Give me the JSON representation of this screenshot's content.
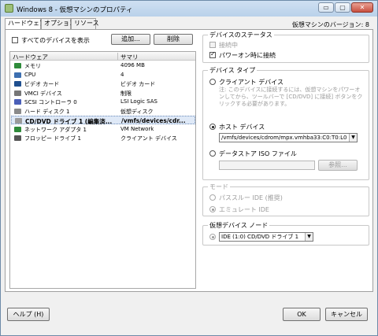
{
  "window": {
    "title": "Windows 8 - 仮想マシンのプロパティ"
  },
  "title_controls": {
    "minimize": "▭",
    "maximize": "▢",
    "close": "✕"
  },
  "tabs": [
    {
      "label": "ハードウェア",
      "active": true
    },
    {
      "label": "オプション",
      "active": false
    },
    {
      "label": "リソース",
      "active": false
    }
  ],
  "vm_version": "仮想マシンのバージョン: 8",
  "left": {
    "show_all_label": "すべてのデバイスを表示",
    "add_button": "追加...",
    "remove_button": "削除",
    "columns": {
      "hardware": "ハードウェア",
      "summary": "サマリ"
    },
    "devices": [
      {
        "name": "メモリ",
        "summary": "4096 MB",
        "icon": "memory-icon",
        "color": "#2e8b3a",
        "selected": false
      },
      {
        "name": "CPU",
        "summary": "4",
        "icon": "cpu-icon",
        "color": "#3d6fb0",
        "selected": false
      },
      {
        "name": "ビデオ カード",
        "summary": "ビデオ カード",
        "icon": "video-card-icon",
        "color": "#1f4f8f",
        "selected": false
      },
      {
        "name": "VMCI デバイス",
        "summary": "制限",
        "icon": "vmci-device-icon",
        "color": "#777777",
        "selected": false
      },
      {
        "name": "SCSI コントローラ 0",
        "summary": "LSI Logic SAS",
        "icon": "scsi-controller-icon",
        "color": "#4a5fb8",
        "selected": false
      },
      {
        "name": "ハード ディスク 1",
        "summary": "仮想ディスク",
        "icon": "hard-disk-icon",
        "color": "#8a8a8a",
        "selected": false
      },
      {
        "name": "CD/DVD ドライブ 1 (編集済...",
        "summary": "/vmfs/devices/cdr...",
        "icon": "cd-dvd-drive-icon",
        "color": "#9a9a9a",
        "selected": true
      },
      {
        "name": "ネットワーク アダプタ 1",
        "summary": "VM Network",
        "icon": "network-adapter-icon",
        "color": "#2f8a3a",
        "selected": false
      },
      {
        "name": "フロッピー ドライブ 1",
        "summary": "クライアント デバイス",
        "icon": "floppy-drive-icon",
        "color": "#555555",
        "selected": false
      }
    ]
  },
  "right": {
    "status": {
      "title": "デバイスのステータス",
      "connected": "接続中",
      "connect_at_power_on": "パワーオン時に接続"
    },
    "device_type": {
      "title": "デバイス タイプ",
      "client_device": "クライアント デバイス",
      "client_note": "注: このデバイスに接続するには、仮想マシンをパワーオンしてから、ツールバーで [CD/DVD] に接続] ボタンをクリックする必要があります。",
      "host_device": "ホスト デバイス",
      "host_device_value": "/vmfs/devices/cdrom/mpx.vmhba33:C0:T0:L0",
      "datastore_iso": "データストア ISO ファイル",
      "browse_button": "参照..."
    },
    "mode": {
      "title": "モード",
      "passthrough": "パススルー IDE (推奨)",
      "emulate": "エミュレート IDE"
    },
    "virtual_device_node": {
      "title": "仮想デバイス ノード",
      "value": "IDE (1:0) CD/DVD ドライブ 1"
    }
  },
  "footer": {
    "help": "ヘルプ (H)",
    "ok": "OK",
    "cancel": "キャンセル"
  }
}
